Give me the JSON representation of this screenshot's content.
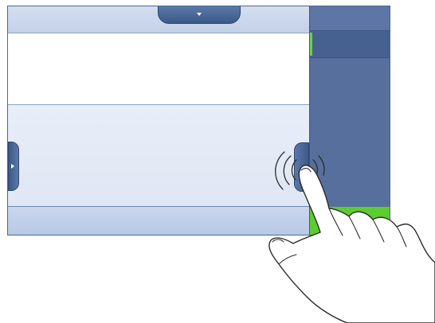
{
  "icons": {
    "top_tab": "chevron-down-icon",
    "left_tab": "chevron-right-icon",
    "gesture": "swipe-gesture-icon"
  },
  "colors": {
    "panel_blue": "#576f9d",
    "tab_blue": "#4a6696",
    "accent_green": "#5ccc2f",
    "screen_light": "#eef2f8"
  }
}
